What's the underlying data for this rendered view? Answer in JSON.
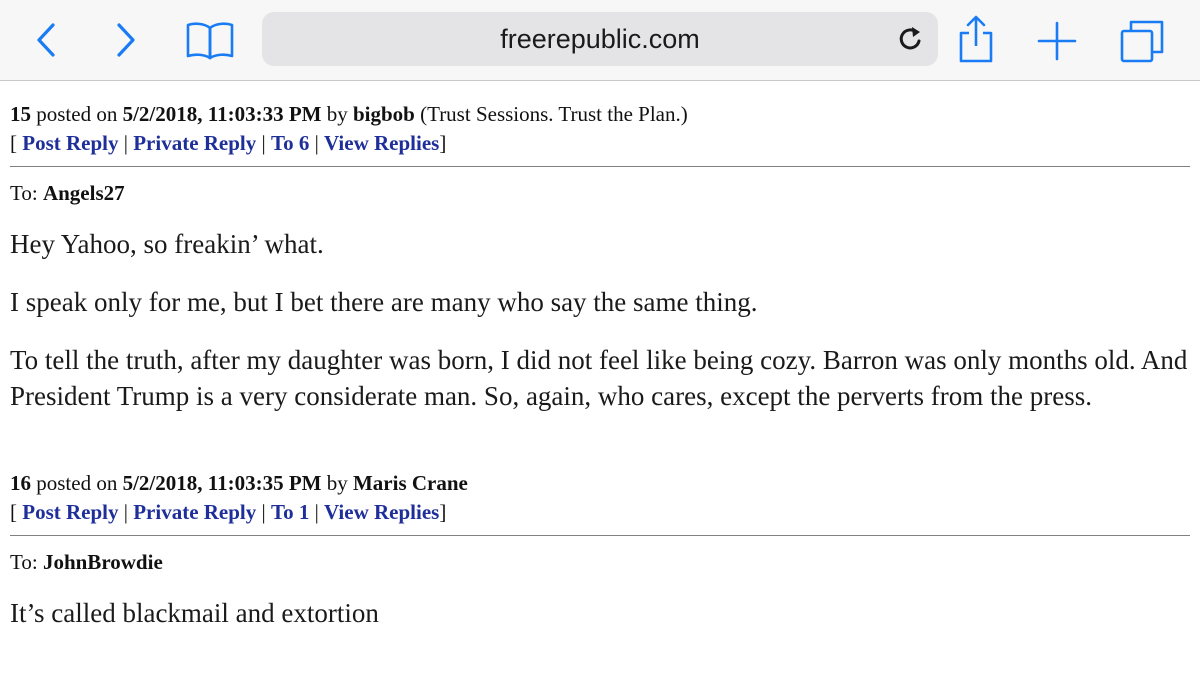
{
  "browser": {
    "url": "freerepublic.com",
    "icons": {
      "back": "chevron-left-icon",
      "forward": "chevron-right-icon",
      "bookmarks": "book-icon",
      "reload": "reload-icon",
      "share": "share-icon",
      "new_tab": "plus-icon",
      "tabs": "tabs-icon"
    },
    "accent_color": "#1a7cf5"
  },
  "posts": [
    {
      "number": "15",
      "posted_on": " posted on ",
      "datetime": "5/2/2018, 11:03:33 PM",
      "by": " by ",
      "author": "bigbob",
      "tagline": " (Trust Sessions. Trust the Plan.)",
      "links": {
        "open": "[ ",
        "post_reply": "Post Reply",
        "sep": " | ",
        "private_reply": "Private Reply",
        "to_link": "To 6",
        "view_replies": "View Replies",
        "close": "]"
      },
      "to_label": "To: ",
      "to_user": "Angels27",
      "body": [
        "Hey Yahoo, so freakin’ what.",
        "I speak only for me, but I bet there are many who say the same thing.",
        "To tell the truth, after my daughter was born, I did not feel like being cozy. Barron was only months old. And President Trump is a very considerate man. So, again, who cares, except the perverts from the press."
      ]
    },
    {
      "number": "16",
      "posted_on": " posted on ",
      "datetime": "5/2/2018, 11:03:35 PM",
      "by": " by ",
      "author": "Maris Crane",
      "links": {
        "open": "[ ",
        "post_reply": "Post Reply",
        "sep": " | ",
        "private_reply": "Private Reply",
        "to_link": "To 1",
        "view_replies": "View Replies",
        "close": "]"
      },
      "to_label": "To: ",
      "to_user": "JohnBrowdie",
      "body": [
        "It’s called blackmail and extortion"
      ]
    }
  ],
  "colors": {
    "link": "#1f2f9a",
    "text": "#111111"
  }
}
